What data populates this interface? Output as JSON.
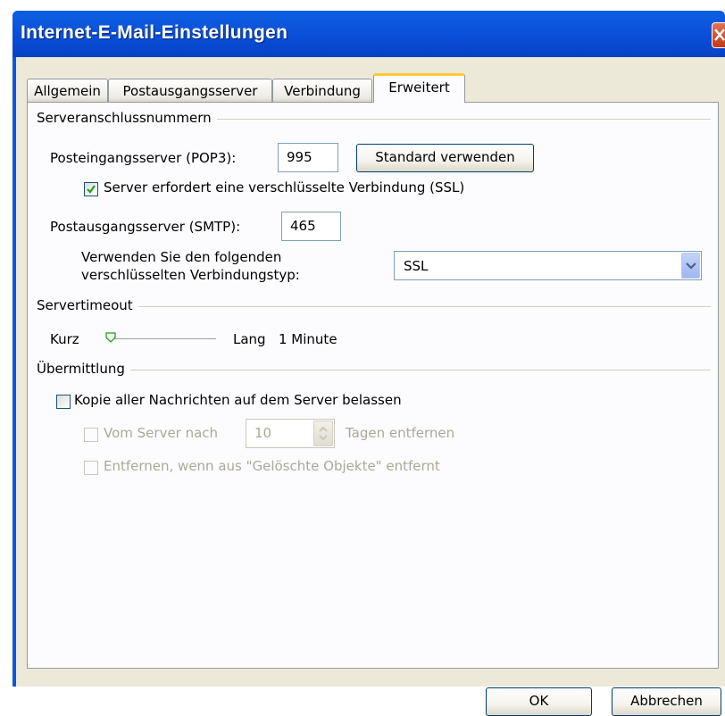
{
  "window": {
    "title": "Internet-E-Mail-Einstellungen"
  },
  "tabs": [
    {
      "label": "Allgemein",
      "active": false
    },
    {
      "label": "Postausgangsserver",
      "active": false
    },
    {
      "label": "Verbindung",
      "active": false
    },
    {
      "label": "Erweitert",
      "active": true
    }
  ],
  "server_ports": {
    "group_label": "Serveranschlussnummern",
    "incoming_label": "Posteingangsserver (POP3):",
    "incoming_value": "995",
    "default_button": "Standard verwenden",
    "ssl_required_label": "Server erfordert eine verschlüsselte Verbindung (SSL)",
    "ssl_required_checked": true,
    "outgoing_label": "Postausgangsserver (SMTP):",
    "outgoing_value": "465",
    "encryption_label_line1": "Verwenden Sie den folgenden",
    "encryption_label_line2": "verschlüsselten Verbindungstyp:",
    "encryption_value": "SSL"
  },
  "timeout": {
    "group_label": "Servertimeout",
    "short_label": "Kurz",
    "long_label": "Lang",
    "value_text": "1 Minute",
    "slider_level": 0.08
  },
  "delivery": {
    "group_label": "Übermittlung",
    "keep_copy_label": "Kopie aller Nachrichten auf dem Server belassen",
    "keep_copy_checked": false,
    "remove_after_label": "Vom Server nach",
    "remove_after_days": "10",
    "remove_after_suffix": "Tagen entfernen",
    "remove_when_deleted_label": "Entfernen, wenn aus \"Gelöschte Objekte\" entfernt"
  },
  "footer": {
    "ok_label": "OK",
    "cancel_label": "Abbrechen"
  },
  "colors": {
    "titlebar": "#0a4ed8",
    "dialog_bg": "#ece9d8",
    "active_tab_accent": "#ffc83c",
    "checkmark": "#21a121"
  },
  "icons": {
    "close": "close-icon",
    "dropdown": "chevron-down-icon",
    "spinner": "spin-arrows-icon",
    "checkmark": "checkmark-icon"
  }
}
